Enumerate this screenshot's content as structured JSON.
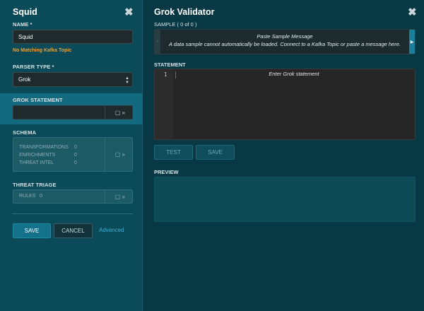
{
  "left_panel": {
    "title": "Squid",
    "name_label": "NAME *",
    "name_value": "Squid",
    "name_warning": "No Matching Kafka Topic",
    "parser_type_label": "PARSER TYPE *",
    "parser_type_value": "Grok",
    "grok_statement_label": "GROK STATEMENT",
    "schema": {
      "label": "SCHEMA",
      "rows": [
        {
          "name": "TRANSFORMATIONS",
          "count": "0"
        },
        {
          "name": "ENRICHMENTS",
          "count": "0"
        },
        {
          "name": "THREAT INTEL",
          "count": "0"
        }
      ]
    },
    "threat_triage": {
      "label": "THREAT TRIAGE",
      "rules_label": "RULES",
      "rules_count": "0"
    },
    "save_label": "SAVE",
    "cancel_label": "CANCEL",
    "advanced_label": "Advanced"
  },
  "right_panel": {
    "title": "Grok Validator",
    "sample_label": "SAMPLE ( 0 of 0 )",
    "sample_title": "Paste Sample Message",
    "sample_message": "A data sample cannot automatically be loaded. Connect to a Kafka Topic or paste a message here.",
    "statement_label": "STATEMENT",
    "line_number": "1",
    "statement_placeholder": "Enter Grok statement",
    "test_label": "TEST",
    "save_label": "SAVE",
    "preview_label": "PREVIEW"
  },
  "icons": {
    "close": "close-icon",
    "expand": "book-expand-icon",
    "chevron_left": "chevron-left-icon",
    "chevron_right": "chevron-right-icon",
    "select_caret": "select-caret-icon"
  },
  "colors": {
    "left_bg": "#0b4a58",
    "right_bg": "#073844",
    "accent": "#13728a",
    "warning": "#e8a23a",
    "link": "#3ab3d6"
  }
}
